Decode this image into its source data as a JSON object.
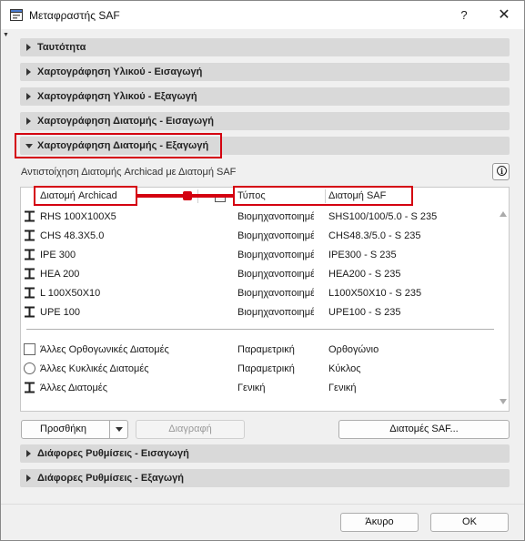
{
  "window": {
    "title": "Μεταφραστής SAF",
    "help_label": "?",
    "close_label": "✕"
  },
  "sections": {
    "identity": "Ταυτότητα",
    "material_import": "Χαρτογράφηση Υλικού - Εισαγωγή",
    "material_export": "Χαρτογράφηση Υλικού - Εξαγωγή",
    "profile_import": "Χαρτογράφηση Διατομής - Εισαγωγή",
    "profile_export": "Χαρτογράφηση Διατομής - Εξαγωγή",
    "misc_import": "Διάφορες Ρυθμίσεις - Εισαγωγή",
    "misc_export": "Διάφορες Ρυθμίσεις - Εξαγωγή"
  },
  "mapping": {
    "subtitle": "Αντιστοίχηση Διατομής Archicad με Διατομή SAF",
    "info_label": "i",
    "columns": {
      "archicad": "Διατομή Archicad",
      "type": "Τύπος",
      "saf": "Διατομή SAF"
    },
    "rows": [
      {
        "name": "RHS 100X100X5",
        "type": "Βιομηχανοποιημένη",
        "saf": "SHS100/100/5.0 - S 235",
        "icon": "i-beam-icon"
      },
      {
        "name": "CHS 48.3X5.0",
        "type": "Βιομηχανοποιημένη",
        "saf": "CHS48.3/5.0 - S 235",
        "icon": "i-beam-icon"
      },
      {
        "name": "IPE 300",
        "type": "Βιομηχανοποιημένη",
        "saf": "IPE300 - S 235",
        "icon": "i-beam-icon"
      },
      {
        "name": "HEA 200",
        "type": "Βιομηχανοποιημένη",
        "saf": "HEA200 - S 235",
        "icon": "i-beam-icon"
      },
      {
        "name": "L 100X50X10",
        "type": "Βιομηχανοποιημένη",
        "saf": "L100X50X10 - S 235",
        "icon": "i-beam-icon"
      },
      {
        "name": "UPE 100",
        "type": "Βιομηχανοποιημένη",
        "saf": "UPE100 - S 235",
        "icon": "i-beam-icon"
      }
    ],
    "other_rows": [
      {
        "name": "Άλλες Ορθογωνικές Διατομές",
        "type": "Παραμετρική",
        "saf": "Ορθογώνιο",
        "icon": "square-profile-icon"
      },
      {
        "name": "Άλλες Κυκλικές Διατομές",
        "type": "Παραμετρική",
        "saf": "Κύκλος",
        "icon": "circle-profile-icon"
      },
      {
        "name": "Άλλες Διατομές",
        "type": "Γενική",
        "saf": "Γενική",
        "icon": "i-beam-icon"
      }
    ]
  },
  "buttons": {
    "add": "Προσθήκη",
    "delete": "Διαγραφή",
    "saf_profiles": "Διατομές SAF...",
    "cancel": "Άκυρο",
    "ok": "OK"
  },
  "colors": {
    "annotation_red": "#d40010",
    "section_bg": "#d9d9d9",
    "dialog_bg": "#f0f0f0"
  }
}
